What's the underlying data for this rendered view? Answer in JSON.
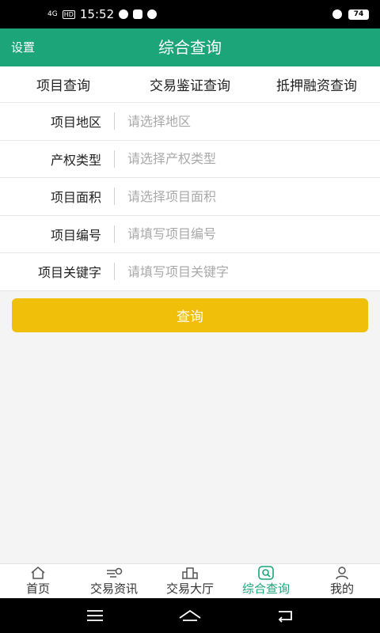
{
  "status_bar": {
    "network": "4G",
    "hd": "HD",
    "time": "15:52",
    "battery": "74"
  },
  "header": {
    "settings_label": "设置",
    "title": "综合查询"
  },
  "tabs": [
    {
      "label": "项目查询"
    },
    {
      "label": "交易鉴证查询"
    },
    {
      "label": "抵押融资查询"
    }
  ],
  "form": {
    "fields": [
      {
        "label": "项目地区",
        "placeholder": "请选择地区",
        "value": ""
      },
      {
        "label": "产权类型",
        "placeholder": "请选择产权类型",
        "value": ""
      },
      {
        "label": "项目面积",
        "placeholder": "请选择项目面积",
        "value": ""
      },
      {
        "label": "项目编号",
        "placeholder": "请填写项目编号",
        "value": ""
      },
      {
        "label": "项目关键字",
        "placeholder": "请填写项目关键字",
        "value": ""
      }
    ],
    "query_button": "查询"
  },
  "bottom_nav": {
    "items": [
      {
        "label": "首页",
        "icon": "home-icon"
      },
      {
        "label": "交易资讯",
        "icon": "news-icon"
      },
      {
        "label": "交易大厅",
        "icon": "building-icon"
      },
      {
        "label": "综合查询",
        "icon": "search-icon"
      },
      {
        "label": "我的",
        "icon": "user-icon"
      }
    ],
    "active_index": 3
  },
  "colors": {
    "primary": "#1da57a",
    "button": "#f0bf0a"
  }
}
